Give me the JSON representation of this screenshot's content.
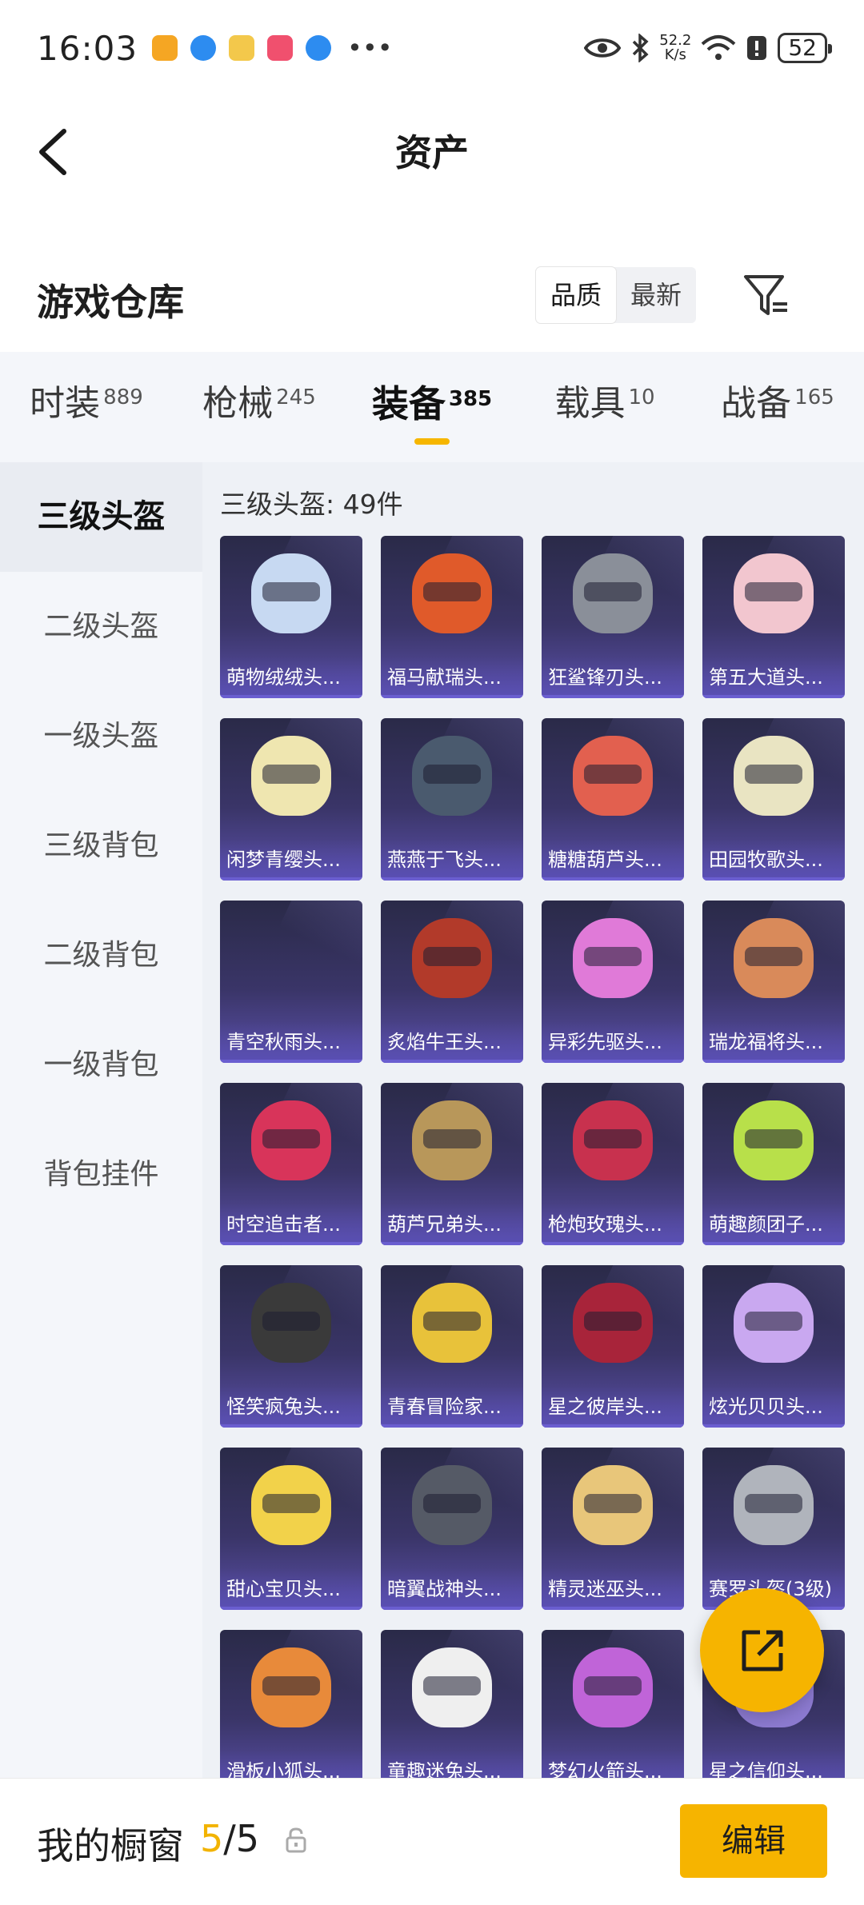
{
  "status_bar": {
    "time": "16:03",
    "net_speed_value": "52.2",
    "net_speed_unit": "K/s",
    "battery": "52",
    "app_icon_colors": [
      "#f5a623",
      "#2d8cf0",
      "#f3c84b",
      "#f0506e",
      "#2d8cf0"
    ]
  },
  "header": {
    "title": "资产"
  },
  "warehouse": {
    "title": "游戏仓库",
    "sort_options": [
      "品质",
      "最新"
    ],
    "sort_active": "品质"
  },
  "tabs": [
    {
      "label": "时装",
      "count": "889"
    },
    {
      "label": "枪械",
      "count": "245"
    },
    {
      "label": "装备",
      "count": "385",
      "active": true
    },
    {
      "label": "载具",
      "count": "10"
    },
    {
      "label": "战备",
      "count": "165"
    }
  ],
  "sidebar": [
    {
      "label": "三级头盔",
      "active": true
    },
    {
      "label": "二级头盔"
    },
    {
      "label": "一级头盔"
    },
    {
      "label": "三级背包"
    },
    {
      "label": "二级背包"
    },
    {
      "label": "一级背包"
    },
    {
      "label": "背包挂件"
    }
  ],
  "content": {
    "count_label": "三级头盔: 49件",
    "items": [
      {
        "name": "萌物绒绒头...",
        "color": "#c7d9f2"
      },
      {
        "name": "福马献瑞头...",
        "color": "#e05a2a"
      },
      {
        "name": "狂鲨锋刃头...",
        "color": "#8a8f99"
      },
      {
        "name": "第五大道头...",
        "color": "#f2c6cf"
      },
      {
        "name": "闲梦青缨头...",
        "color": "#efe6b0"
      },
      {
        "name": "燕燕于飞头...",
        "color": "#4a5a6e"
      },
      {
        "name": "糖糖葫芦头...",
        "color": "#e2604f"
      },
      {
        "name": "田园牧歌头...",
        "color": "#e9e4c2"
      },
      {
        "name": "青空秋雨头...",
        "color": ""
      },
      {
        "name": "炙焰牛王头...",
        "color": "#b23a2a"
      },
      {
        "name": "异彩先驱头...",
        "color": "#e07ad8"
      },
      {
        "name": "瑞龙福将头...",
        "color": "#d98a5a"
      },
      {
        "name": "时空追击者...",
        "color": "#d8345a"
      },
      {
        "name": "葫芦兄弟头...",
        "color": "#b8975a"
      },
      {
        "name": "枪炮玫瑰头...",
        "color": "#c8314e"
      },
      {
        "name": "萌趣颜团子...",
        "color": "#b8e04a"
      },
      {
        "name": "怪笑疯兔头...",
        "color": "#3a3a3a"
      },
      {
        "name": "青春冒险家...",
        "color": "#e8c23a"
      },
      {
        "name": "星之彼岸头...",
        "color": "#a8243a"
      },
      {
        "name": "炫光贝贝头...",
        "color": "#c9a8f0"
      },
      {
        "name": "甜心宝贝头...",
        "color": "#f2d24a"
      },
      {
        "name": "暗翼战神头...",
        "color": "#555a66"
      },
      {
        "name": "精灵迷巫头...",
        "color": "#e8c67a"
      },
      {
        "name": "赛罗头盔(3级)",
        "color": "#b0b4bc"
      },
      {
        "name": "滑板小狐头...",
        "color": "#e88a3a"
      },
      {
        "name": "童趣迷兔头...",
        "color": "#efefef"
      },
      {
        "name": "梦幻火箭头...",
        "color": "#c064d8"
      },
      {
        "name": "星之信仰头...",
        "color": "#8c7ad0"
      }
    ]
  },
  "bottom_bar": {
    "label": "我的橱窗",
    "count_current": "5",
    "count_total": "/5",
    "edit_label": "编辑"
  },
  "colors": {
    "accent": "#f6b400",
    "card_bg": "#3a3568"
  }
}
